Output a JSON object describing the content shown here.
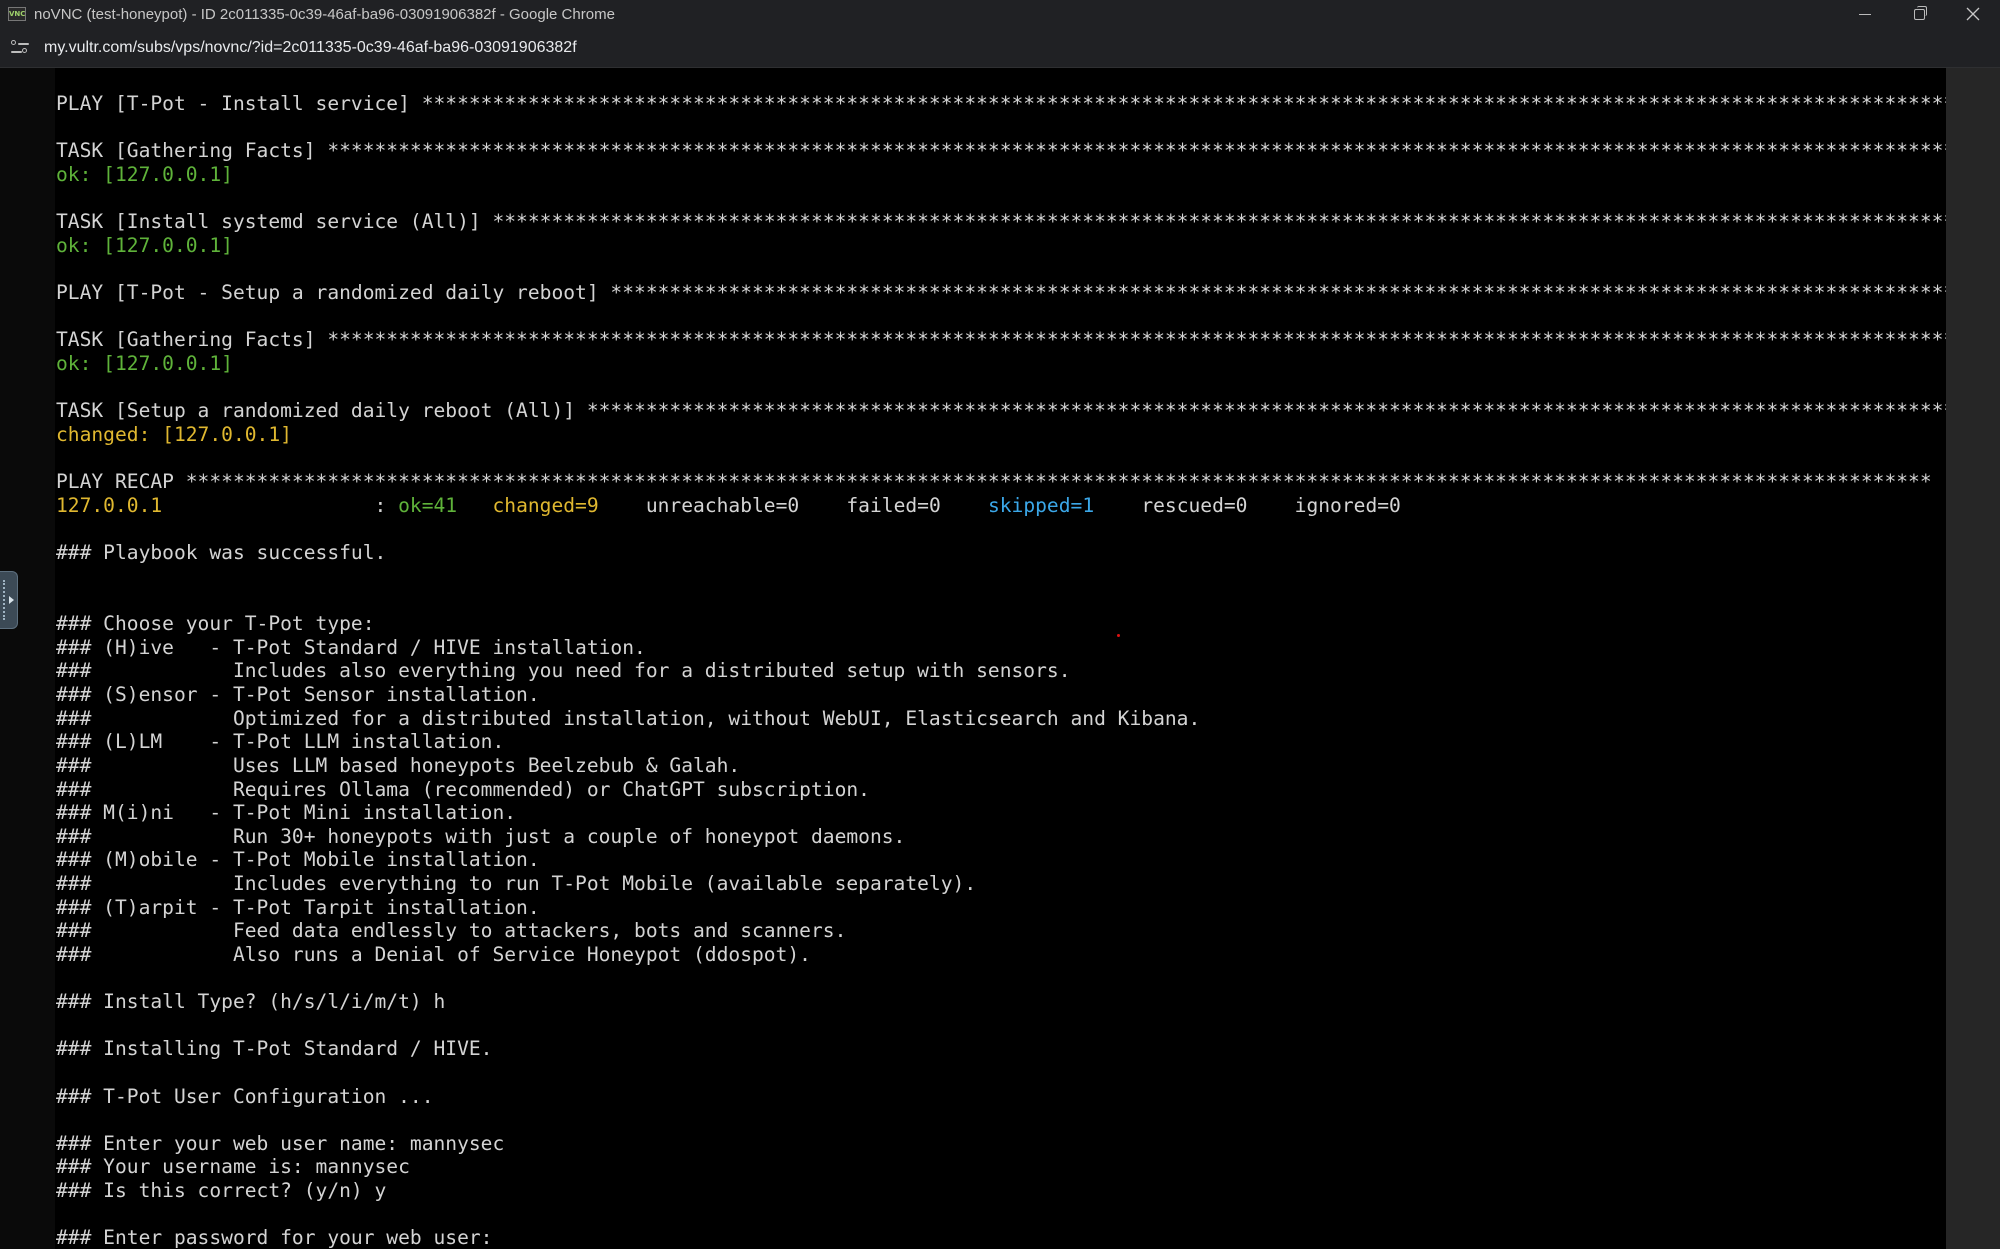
{
  "window": {
    "app_icon_text": "VNC",
    "title": "noVNC (test-honeypot) - ID 2c011335-0c39-46af-ba96-03091906382f - Google Chrome"
  },
  "addressbar": {
    "url": "my.vultr.com/subs/vps/novnc/?id=2c011335-0c39-46af-ba96-03091906382f"
  },
  "colors": {
    "ok": "#5fb33a",
    "changed": "#e0b830",
    "skipped": "#3ba7e8",
    "default_text": "#d4d4d4"
  },
  "terminal": {
    "play1": "PLAY [T-Pot - Install service] ****************************************************************************************************************************************************",
    "task1": "TASK [Gathering Facts] ****************************************************************************************************************************************************",
    "ok1": "ok: [127.0.0.1]",
    "task2": "TASK [Install systemd service (All)] ****************************************************************************************************************************************************",
    "ok2": "ok: [127.0.0.1]",
    "play2": "PLAY [T-Pot - Setup a randomized daily reboot] ****************************************************************************************************************************************************",
    "task3": "TASK [Gathering Facts] ****************************************************************************************************************************************************",
    "ok3": "ok: [127.0.0.1]",
    "task4": "TASK [Setup a randomized daily reboot (All)] ****************************************************************************************************************************************************",
    "changed1": "changed: [127.0.0.1]",
    "recap_header": "PLAY RECAP ****************************************************************************************************************************************************",
    "recap": {
      "host": "127.0.0.1",
      "sep": "                  : ",
      "ok": "ok=41",
      "gap1": "   ",
      "changed": "changed=9",
      "gap2": "    ",
      "unreachable": "unreachable=0",
      "gap3": "    ",
      "failed": "failed=0",
      "gap4": "    ",
      "skipped": "skipped=1",
      "gap5": "    ",
      "rescued": "rescued=0",
      "gap6": "    ",
      "ignored": "ignored=0"
    },
    "success": "### Playbook was successful.",
    "choose": "### Choose your T-Pot type:",
    "hive1": "### (H)ive   - T-Pot Standard / HIVE installation.",
    "hive2": "###            Includes also everything you need for a distributed setup with sensors.",
    "sensor1": "### (S)ensor - T-Pot Sensor installation.",
    "sensor2": "###            Optimized for a distributed installation, without WebUI, Elasticsearch and Kibana.",
    "llm1": "### (L)LM    - T-Pot LLM installation.",
    "llm2": "###            Uses LLM based honeypots Beelzebub & Galah.",
    "llm3": "###            Requires Ollama (recommended) or ChatGPT subscription.",
    "mini1": "### M(i)ni   - T-Pot Mini installation.",
    "mini2": "###            Run 30+ honeypots with just a couple of honeypot daemons.",
    "mobile1": "### (M)obile - T-Pot Mobile installation.",
    "mobile2": "###            Includes everything to run T-Pot Mobile (available separately).",
    "tarpit1": "### (T)arpit - T-Pot Tarpit installation.",
    "tarpit2": "###            Feed data endlessly to attackers, bots and scanners.",
    "tarpit3": "###            Also runs a Denial of Service Honeypot (ddospot).",
    "install_type": "### Install Type? (h/s/l/i/m/t) h",
    "installing": "### Installing T-Pot Standard / HIVE.",
    "user_config": "### T-Pot User Configuration ...",
    "enter_user": "### Enter your web user name: mannysec",
    "your_user": "### Your username is: mannysec",
    "confirm": "### Is this correct? (y/n) y",
    "enter_pass": "### Enter password for your web user:"
  }
}
